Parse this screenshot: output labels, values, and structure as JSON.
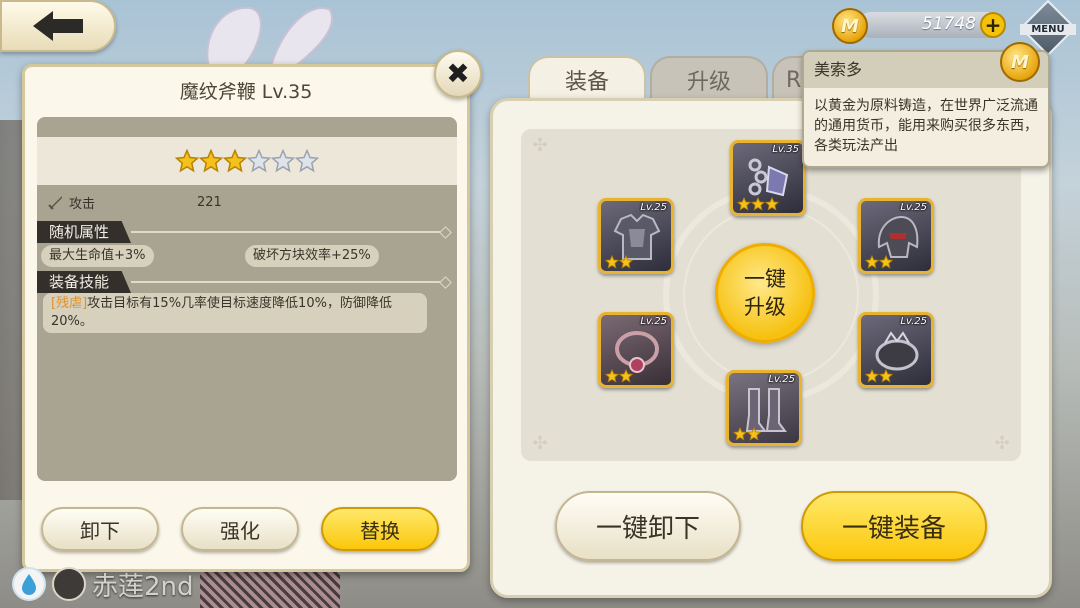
{
  "back_label": "",
  "equip_panel": {
    "title": "魔纹斧鞭 Lv.35",
    "close_label": "✖",
    "stars_filled": 3,
    "stars_total": 6,
    "attack_label": "攻击",
    "attack_value": "221",
    "random_attr_title": "随机属性",
    "random_attrs": [
      "最大生命值+3%",
      "破坏方块效率+25%"
    ],
    "skill_title": "装备技能",
    "skill_tag": "[残虐]",
    "skill_text": "攻击目标有15%几率使目标速度降低10%，防御降低20%。",
    "buttons": {
      "unequip": "卸下",
      "enhance": "强化",
      "replace": "替换"
    }
  },
  "character_name": "赤莲2nd",
  "currency": {
    "amount": "51748",
    "coin_symbol": "M",
    "menu_label": "MENU"
  },
  "tabs": [
    {
      "label": "装备",
      "active": true
    },
    {
      "label": "升级",
      "active": false
    },
    {
      "label": "R",
      "active": false
    }
  ],
  "tooltip": {
    "title": "美索多",
    "body": "以黄金为原料铸造，在世界广泛流通的通用货币，能用来购买很多东西，各类玩法产出"
  },
  "slots": [
    {
      "name": "weapon",
      "level": "Lv.35",
      "stars": 3
    },
    {
      "name": "chest",
      "level": "Lv.25",
      "stars": 2
    },
    {
      "name": "helmet",
      "level": "Lv.25",
      "stars": 2
    },
    {
      "name": "necklace",
      "level": "Lv.25",
      "stars": 2
    },
    {
      "name": "bracelet",
      "level": "Lv.25",
      "stars": 2
    },
    {
      "name": "boots",
      "level": "Lv.25",
      "stars": 2
    }
  ],
  "upgrade_all": {
    "line1": "一键",
    "line2": "升级"
  },
  "bottom_buttons": {
    "unequip_all": "一键卸下",
    "equip_all": "一键装备"
  },
  "colors": {
    "gold": "#f6c110",
    "panel": "#fbf7ea",
    "dark_tag": "#33302b"
  }
}
